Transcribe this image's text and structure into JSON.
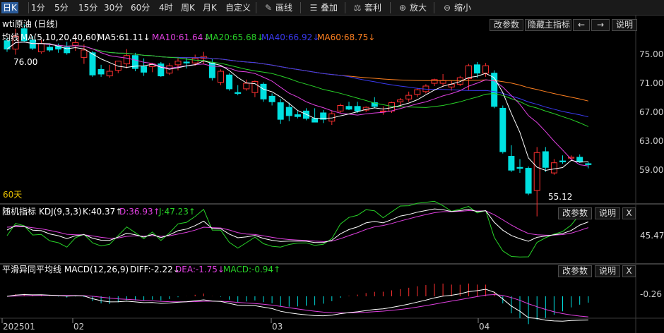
{
  "toolbar": {
    "periods": [
      "日K",
      "1分",
      "5分",
      "15分",
      "30分",
      "60分",
      "4时",
      "周K",
      "月K",
      "自定义"
    ],
    "tools": [
      {
        "label": "画线",
        "icon": "pencil-icon"
      },
      {
        "label": "叠加",
        "icon": "stack-icon"
      },
      {
        "label": "套利",
        "icon": "arbitrage-icon"
      },
      {
        "label": "放大",
        "icon": "zoom-in-icon"
      },
      {
        "label": "缩小",
        "icon": "zoom-out-icon"
      }
    ]
  },
  "main_panel": {
    "title": "wti原油 (日线)",
    "indicator_name": "均线",
    "indicator_params": "MA(5,10,20,40,60)",
    "ma_labels": [
      {
        "text": "MA5:61.11↓",
        "color": "#ffffff"
      },
      {
        "text": "MA10:61.64↓",
        "color": "#e040e0"
      },
      {
        "text": "MA20:65.68↓",
        "color": "#28d228"
      },
      {
        "text": "MA40:66.92↓",
        "color": "#3a3af0"
      },
      {
        "text": "MA60:68.75↓",
        "color": "#ff8020"
      }
    ],
    "buttons": {
      "params": "改参数",
      "hide": "隐藏主指标",
      "prev": "←",
      "next": "→",
      "help": "说明"
    },
    "y_ticks": [
      "75.00",
      "71.00",
      "67.00",
      "63.00",
      "59.00"
    ],
    "annotation_high": "76.00",
    "annotation_low": "55.12",
    "period_label": "60天"
  },
  "kdj_panel": {
    "title": "随机指标",
    "params": "KDJ(9,3,3)",
    "values": [
      {
        "text": "K:40.37↑",
        "color": "#ffffff"
      },
      {
        "text": "D:36.93↑",
        "color": "#e040e0"
      },
      {
        "text": "J:47.23↑",
        "color": "#28d228"
      }
    ],
    "buttons": {
      "params": "改参数",
      "help": "说明",
      "close": "X"
    },
    "y_ticks": [
      "45.47"
    ]
  },
  "macd_panel": {
    "title": "平滑异同平均线",
    "params": "MACD(12,26,9)",
    "values": [
      {
        "text": "DIFF:-2.22↓",
        "color": "#ffffff"
      },
      {
        "text": "DEA:-1.75↓",
        "color": "#e040e0"
      },
      {
        "text": "MACD:-0.94↑",
        "color": "#28d228"
      }
    ],
    "buttons": {
      "params": "改参数",
      "help": "说明",
      "close": "X"
    },
    "y_ticks": [
      "-0.26"
    ]
  },
  "x_axis": {
    "labels": [
      "202501",
      "02",
      "03",
      "04"
    ]
  },
  "colors": {
    "up": "#ff3030",
    "down": "#00e0e0",
    "grid": "#3a3a3a",
    "axis_text": "#cccccc",
    "yellow": "#e8c000"
  },
  "chart_data": {
    "type": "candlestick",
    "y_range": [
      55,
      77
    ],
    "candles": [
      {
        "o": 74.1,
        "h": 74.4,
        "l": 72.9,
        "c": 73.2
      },
      {
        "o": 73.2,
        "h": 75.4,
        "l": 72.6,
        "c": 74.6
      },
      {
        "o": 75.4,
        "h": 75.9,
        "l": 73.9,
        "c": 74.1
      },
      {
        "o": 74.2,
        "h": 74.6,
        "l": 73.1,
        "c": 73.3
      },
      {
        "o": 72.9,
        "h": 74.2,
        "l": 72.7,
        "c": 73.8
      },
      {
        "o": 73.4,
        "h": 73.7,
        "l": 72.9,
        "c": 73.1
      },
      {
        "o": 73.5,
        "h": 73.8,
        "l": 72.8,
        "c": 73.2
      },
      {
        "o": 73.4,
        "h": 74.0,
        "l": 72.6,
        "c": 72.8
      },
      {
        "o": 73.6,
        "h": 74.8,
        "l": 73.0,
        "c": 73.9
      },
      {
        "o": 72.3,
        "h": 73.7,
        "l": 71.6,
        "c": 73.1
      },
      {
        "o": 72.8,
        "h": 73.0,
        "l": 70.2,
        "c": 70.4
      },
      {
        "o": 71.0,
        "h": 71.5,
        "l": 70.2,
        "c": 70.5
      },
      {
        "o": 70.3,
        "h": 71.5,
        "l": 70.1,
        "c": 70.8
      },
      {
        "o": 70.9,
        "h": 71.9,
        "l": 70.6,
        "c": 71.9
      },
      {
        "o": 71.6,
        "h": 73.2,
        "l": 71.1,
        "c": 72.5
      },
      {
        "o": 72.5,
        "h": 72.8,
        "l": 70.8,
        "c": 71.1
      },
      {
        "o": 71.3,
        "h": 72.2,
        "l": 70.3,
        "c": 70.7
      },
      {
        "o": 71.3,
        "h": 71.7,
        "l": 70.7,
        "c": 71.6
      },
      {
        "o": 71.6,
        "h": 71.8,
        "l": 70.2,
        "c": 70.3
      },
      {
        "o": 70.6,
        "h": 71.7,
        "l": 70.4,
        "c": 71.4
      },
      {
        "o": 71.5,
        "h": 72.2,
        "l": 70.9,
        "c": 71.9
      },
      {
        "o": 71.8,
        "h": 72.3,
        "l": 71.1,
        "c": 71.7
      },
      {
        "o": 71.7,
        "h": 72.6,
        "l": 71.4,
        "c": 72.2
      },
      {
        "o": 72.2,
        "h": 72.9,
        "l": 71.6,
        "c": 72.4
      },
      {
        "o": 71.7,
        "h": 72.1,
        "l": 69.8,
        "c": 70.1
      },
      {
        "o": 69.6,
        "h": 71.0,
        "l": 69.3,
        "c": 70.8
      },
      {
        "o": 70.4,
        "h": 70.6,
        "l": 68.7,
        "c": 68.9
      },
      {
        "o": 68.5,
        "h": 69.3,
        "l": 68.2,
        "c": 68.4
      },
      {
        "o": 68.9,
        "h": 69.9,
        "l": 68.7,
        "c": 69.5
      },
      {
        "o": 68.5,
        "h": 69.8,
        "l": 68.0,
        "c": 69.7
      },
      {
        "o": 69.4,
        "h": 69.6,
        "l": 67.5,
        "c": 67.8
      },
      {
        "o": 68.1,
        "h": 68.4,
        "l": 67.1,
        "c": 67.5
      },
      {
        "o": 67.4,
        "h": 67.8,
        "l": 65.1,
        "c": 65.6
      },
      {
        "o": 66.9,
        "h": 67.4,
        "l": 65.4,
        "c": 66.0
      },
      {
        "o": 66.1,
        "h": 66.5,
        "l": 65.7,
        "c": 65.9
      },
      {
        "o": 66.5,
        "h": 66.8,
        "l": 65.5,
        "c": 65.7
      },
      {
        "o": 65.7,
        "h": 66.8,
        "l": 65.4,
        "c": 65.3
      },
      {
        "o": 66.3,
        "h": 66.6,
        "l": 65.2,
        "c": 65.6
      },
      {
        "o": 65.4,
        "h": 66.5,
        "l": 65.0,
        "c": 66.2
      },
      {
        "o": 66.5,
        "h": 67.3,
        "l": 66.3,
        "c": 67.1
      },
      {
        "o": 67.0,
        "h": 67.5,
        "l": 66.6,
        "c": 66.7
      },
      {
        "o": 67.0,
        "h": 67.5,
        "l": 66.3,
        "c": 66.5
      },
      {
        "o": 66.6,
        "h": 67.0,
        "l": 66.4,
        "c": 66.9
      },
      {
        "o": 67.4,
        "h": 68.0,
        "l": 66.8,
        "c": 67.0
      },
      {
        "o": 66.5,
        "h": 67.0,
        "l": 66.1,
        "c": 66.5
      },
      {
        "o": 66.5,
        "h": 67.5,
        "l": 66.3,
        "c": 67.4
      },
      {
        "o": 67.5,
        "h": 67.9,
        "l": 67.0,
        "c": 67.7
      },
      {
        "o": 67.8,
        "h": 68.6,
        "l": 67.5,
        "c": 68.2
      },
      {
        "o": 68.3,
        "h": 69.0,
        "l": 68.0,
        "c": 68.8
      },
      {
        "o": 68.6,
        "h": 69.4,
        "l": 68.4,
        "c": 69.2
      },
      {
        "o": 69.5,
        "h": 70.0,
        "l": 69.2,
        "c": 69.9
      },
      {
        "o": 69.5,
        "h": 70.5,
        "l": 69.1,
        "c": 69.8
      },
      {
        "o": 69.1,
        "h": 69.8,
        "l": 68.7,
        "c": 69.4
      },
      {
        "o": 69.4,
        "h": 70.3,
        "l": 69.2,
        "c": 70.1
      },
      {
        "o": 70.0,
        "h": 71.6,
        "l": 68.7,
        "c": 71.4
      },
      {
        "o": 71.5,
        "h": 71.8,
        "l": 70.1,
        "c": 70.6
      },
      {
        "o": 70.6,
        "h": 71.7,
        "l": 70.2,
        "c": 71.4
      },
      {
        "o": 70.6,
        "h": 70.9,
        "l": 66.8,
        "c": 67.0
      },
      {
        "o": 66.8,
        "h": 67.1,
        "l": 61.9,
        "c": 62.1
      },
      {
        "o": 61.6,
        "h": 62.8,
        "l": 59.9,
        "c": 60.1
      },
      {
        "o": 60.4,
        "h": 61.3,
        "l": 59.8,
        "c": 60.3
      },
      {
        "o": 60.3,
        "h": 60.5,
        "l": 57.4,
        "c": 57.6
      },
      {
        "o": 57.9,
        "h": 62.6,
        "l": 55.1,
        "c": 62.0
      },
      {
        "o": 62.1,
        "h": 62.6,
        "l": 59.9,
        "c": 60.4
      },
      {
        "o": 59.8,
        "h": 61.3,
        "l": 59.6,
        "c": 60.9
      },
      {
        "o": 61.1,
        "h": 61.7,
        "l": 60.8,
        "c": 61.0
      },
      {
        "o": 61.4,
        "h": 61.7,
        "l": 61.2,
        "c": 61.5
      },
      {
        "o": 61.5,
        "h": 61.8,
        "l": 60.9,
        "c": 61.0
      },
      {
        "o": 60.8,
        "h": 61.0,
        "l": 60.3,
        "c": 60.7
      }
    ]
  }
}
